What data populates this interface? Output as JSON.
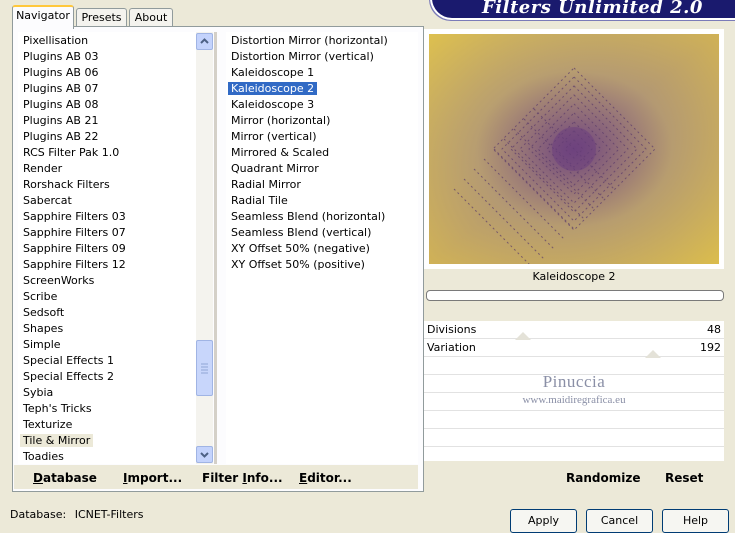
{
  "window": {
    "title": "Filters Unlimited 2.0"
  },
  "tabs": [
    {
      "label": "Navigator",
      "active": true
    },
    {
      "label": "Presets",
      "active": false
    },
    {
      "label": "About",
      "active": false
    }
  ],
  "categories": {
    "items": [
      "Pixellisation",
      "Plugins AB 03",
      "Plugins AB 06",
      "Plugins AB 07",
      "Plugins AB 08",
      "Plugins AB 21",
      "Plugins AB 22",
      "RCS Filter Pak 1.0",
      "Render",
      "Rorshack Filters",
      "Sabercat",
      "Sapphire Filters 03",
      "Sapphire Filters 07",
      "Sapphire Filters 09",
      "Sapphire Filters 12",
      "ScreenWorks",
      "Scribe",
      "Sedsoft",
      "Shapes",
      "Simple",
      "Special Effects 1",
      "Special Effects 2",
      "Sybia",
      "Teph's Tricks",
      "Texturize",
      "Tile & Mirror",
      "Toadies"
    ],
    "selected": "Tile & Mirror"
  },
  "filters": {
    "items": [
      "Distortion Mirror (horizontal)",
      "Distortion Mirror (vertical)",
      "Kaleidoscope 1",
      "Kaleidoscope 2",
      "Kaleidoscope 3",
      "Mirror (horizontal)",
      "Mirror (vertical)",
      "Mirrored & Scaled",
      "Quadrant Mirror",
      "Radial Mirror",
      "Radial Tile",
      "Seamless Blend (horizontal)",
      "Seamless Blend (vertical)",
      "XY Offset 50% (negative)",
      "XY Offset 50% (positive)"
    ],
    "selected": "Kaleidoscope 2"
  },
  "preview": {
    "filter_name": "Kaleidoscope 2",
    "colors": {
      "corner": "#e0c24a",
      "center": "#6b3f7e",
      "edge": "#b9a070"
    }
  },
  "params": [
    {
      "label": "Divisions",
      "value": "48",
      "level": 48
    },
    {
      "label": "Variation",
      "value": "192",
      "level": 192
    }
  ],
  "params_max": 255,
  "watermark": {
    "name": "Pinuccia",
    "url": "www.maidiregrafica.eu"
  },
  "bottom_buttons": {
    "database": {
      "pre": "",
      "u": "D",
      "post": "atabase"
    },
    "import": {
      "pre": "",
      "u": "I",
      "post": "mport..."
    },
    "filter_info": {
      "pre": "Filter ",
      "u": "I",
      "post": "nfo..."
    },
    "editor": {
      "pre": "",
      "u": "E",
      "post": "ditor..."
    },
    "randomize": "Randomize",
    "reset": "Reset"
  },
  "status": {
    "label": "Database:",
    "value": "ICNET-Filters"
  },
  "dialog_buttons": {
    "apply": "Apply",
    "cancel": "Cancel",
    "help": "Help"
  }
}
